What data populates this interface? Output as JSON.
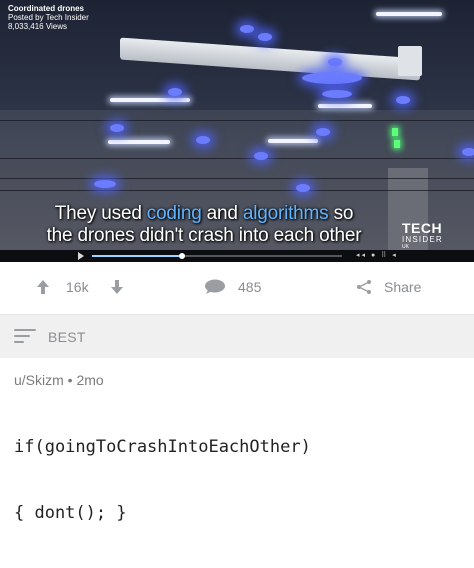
{
  "video": {
    "overlay_title": "Coordinated drones",
    "overlay_posted": "Posted by Tech Insider",
    "overlay_views": "8,033,416 Views",
    "caption_line1_a": "They used ",
    "caption_line1_b": "coding",
    "caption_line1_c": " and ",
    "caption_line1_d": "algorithms",
    "caption_line1_e": " so",
    "caption_line2": "the drones didn't crash into each other",
    "brand_line1": "TECH",
    "brand_line2": "INSIDER",
    "brand_line3": "UK",
    "caption_color": "#5fb3ff",
    "progress": 0.36
  },
  "actions": {
    "upvote_count": "16k",
    "comment_count": "485",
    "share_label": "Share"
  },
  "sort": {
    "label": "BEST"
  },
  "comment": {
    "meta": "u/Skizm • 2mo",
    "line1": "if(goingToCrashIntoEachOther)",
    "line2": "{ dont(); }"
  }
}
